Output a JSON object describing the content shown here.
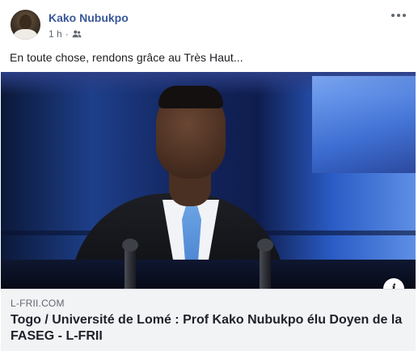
{
  "post": {
    "author": "Kako Nubukpo",
    "time": "1 h",
    "separator": "·",
    "audience_icon": "friends-icon",
    "more_icon": "more-options-icon",
    "text": "En toute chose, rendons grâce au Très Haut..."
  },
  "link": {
    "domain": "L-FRII.COM",
    "title": "Togo / Université de Lomé : Prof Kako Nubukpo élu Doyen de la FASEG - L-FRII",
    "info_label": "i"
  },
  "colors": {
    "author_link": "#385898",
    "meta_text": "#606770",
    "caption_bg": "#f2f3f5"
  }
}
